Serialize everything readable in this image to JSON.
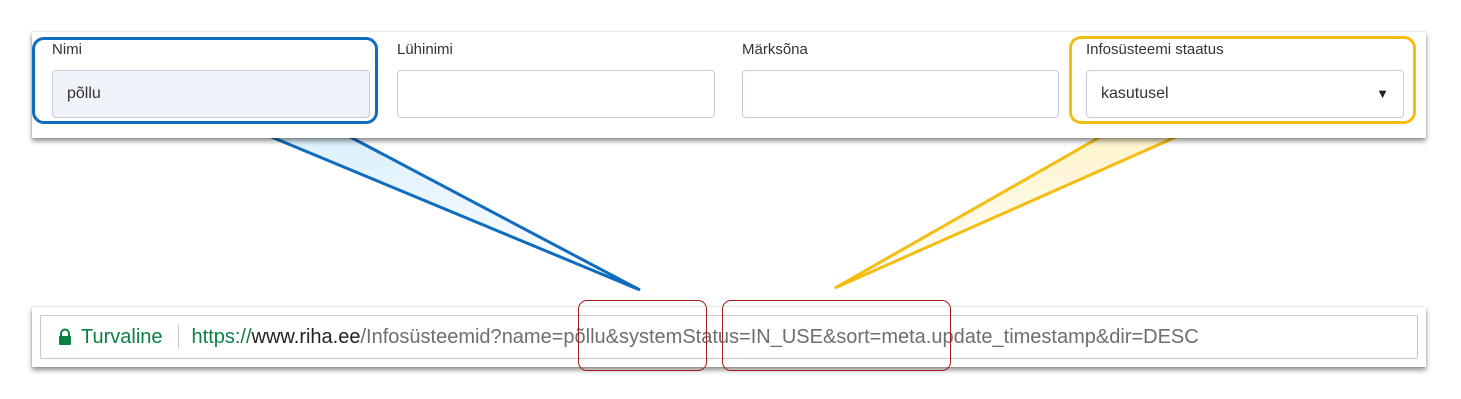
{
  "form": {
    "fields": [
      {
        "label": "Nimi",
        "value": "põllu"
      },
      {
        "label": "Lühinimi",
        "value": ""
      },
      {
        "label": "Märksõna",
        "value": ""
      },
      {
        "label": "Infosüsteemi staatus",
        "value": "kasutusel"
      }
    ]
  },
  "address_bar": {
    "secure_label": "Turvaline",
    "url_scheme": "https://",
    "url_host": "www.riha.ee",
    "url_path": "/Infosüsteemid?",
    "url_param_name": "name=põllu",
    "url_amp1": "&",
    "url_param_status": "systemStatus=IN_USE",
    "url_rest": "&sort=meta.update_timestamp&dir=DESC"
  },
  "colors": {
    "blue_callout": "#0f6cbf",
    "yellow_callout": "#f3bd12",
    "red_highlight": "#a81b1b",
    "secure_green": "#0b8043"
  },
  "icons": [
    "lock-icon",
    "dropdown-caret-icon"
  ]
}
